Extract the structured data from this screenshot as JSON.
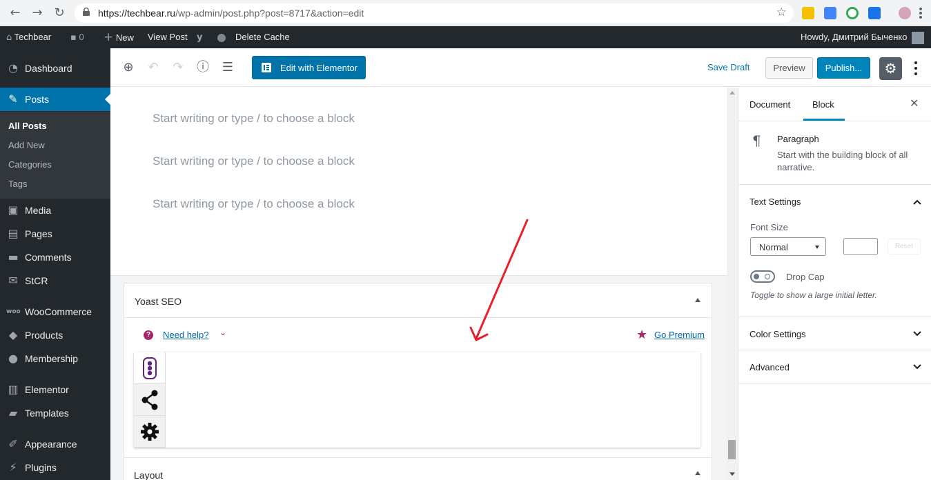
{
  "browser": {
    "url_host": "https://techbear.ru",
    "url_path": "/wp-admin/post.php?post=8717&action=edit"
  },
  "adminbar": {
    "site_name": "Techbear",
    "comments_count": "0",
    "new_label": "New",
    "view_post": "View Post",
    "delete_cache": "Delete Cache",
    "howdy": "Howdy, Дмитрий Быченко"
  },
  "menu": {
    "items": [
      {
        "label": "Dashboard",
        "icon": "dashboard-icon"
      },
      {
        "label": "Posts",
        "icon": "pin-icon"
      },
      {
        "label": "Media",
        "icon": "media-icon"
      },
      {
        "label": "Pages",
        "icon": "pages-icon"
      },
      {
        "label": "Comments",
        "icon": "comments-icon"
      },
      {
        "label": "StCR",
        "icon": "mail-icon"
      },
      {
        "label": "WooCommerce",
        "icon": "woocommerce-icon"
      },
      {
        "label": "Products",
        "icon": "products-icon"
      },
      {
        "label": "Membership",
        "icon": "membership-icon"
      },
      {
        "label": "Elementor",
        "icon": "elementor-icon"
      },
      {
        "label": "Templates",
        "icon": "folder-icon"
      },
      {
        "label": "Appearance",
        "icon": "brush-icon"
      },
      {
        "label": "Plugins",
        "icon": "plug-icon"
      }
    ],
    "submenu": [
      "All Posts",
      "Add New",
      "Categories",
      "Tags"
    ]
  },
  "toolbar": {
    "elementor_label": "Edit with Elementor",
    "save_draft": "Save Draft",
    "preview": "Preview",
    "publish": "Publish..."
  },
  "editor": {
    "placeholders": [
      "Start writing or type / to choose a block",
      "Start writing or type / to choose a block",
      "Start writing or type / to choose a block"
    ]
  },
  "yoast": {
    "title": "Yoast SEO",
    "need_help": "Need help?",
    "go_premium": "Go Premium",
    "tabs": [
      "traffic-light-icon",
      "share-icon",
      "gear-icon"
    ]
  },
  "metabox2": {
    "title": "Layout"
  },
  "sidebar": {
    "tabs": [
      "Document",
      "Block"
    ],
    "active_tab": "Block",
    "block_name": "Paragraph",
    "block_description": "Start with the building block of all narrative.",
    "text_settings": "Text Settings",
    "font_size_label": "Font Size",
    "font_size_value": "Normal",
    "reset": "Reset",
    "drop_cap": "Drop Cap",
    "drop_cap_help": "Toggle to show a large initial letter.",
    "color_settings": "Color Settings",
    "advanced": "Advanced"
  },
  "colors": {
    "wp_blue": "#0073aa",
    "admin_dark": "#23282d",
    "yoast_purple": "#a4286a",
    "annotation_red": "#e8202a"
  }
}
